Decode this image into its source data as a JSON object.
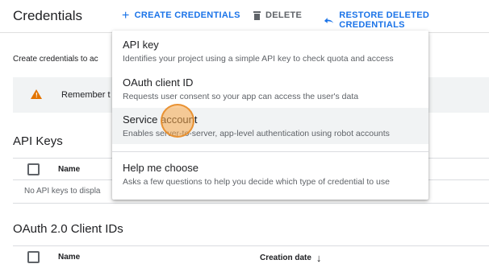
{
  "header": {
    "title": "Credentials",
    "create_label": "CREATE CREDENTIALS",
    "delete_label": "DELETE",
    "restore_label": "RESTORE DELETED CREDENTIALS",
    "icons": {
      "create": "plus-icon",
      "delete": "trash-icon",
      "restore": "undo-arrow-icon"
    }
  },
  "page": {
    "intro_text": "Create credentials to ac",
    "banner_text": "Remember t",
    "api_keys": {
      "title": "API Keys",
      "col_name": "Name",
      "empty_text": "No API keys to displa"
    },
    "oauth": {
      "title": "OAuth 2.0 Client IDs",
      "col_name": "Name",
      "col_created": "Creation date"
    }
  },
  "menu": {
    "items": [
      {
        "title": "API key",
        "desc": "Identifies your project using a simple API key to check quota and access"
      },
      {
        "title": "OAuth client ID",
        "desc": "Requests user consent so your app can access the user's data"
      },
      {
        "title": "Service account",
        "desc": "Enables server-to-server, app-level authentication using robot accounts",
        "highlighted": true
      },
      {
        "title": "Help me choose",
        "desc": "Asks a few questions to help you decide which type of credential to use"
      }
    ]
  },
  "colors": {
    "accent": "#1a73e8",
    "warning": "#e37400",
    "hover": "#f1f3f4",
    "cursor": "#f5a648"
  }
}
